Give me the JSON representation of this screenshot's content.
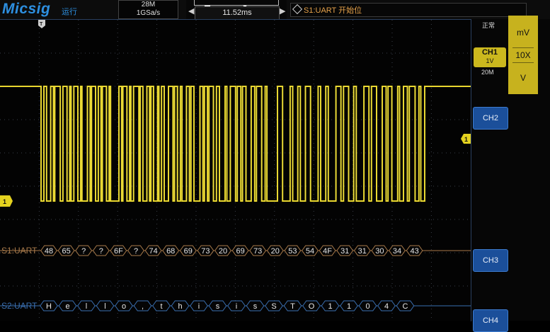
{
  "brand": {
    "logo": "Micsig",
    "subtitle": "运行"
  },
  "acquisition": {
    "memory_depth": "28M",
    "sample_rate": "1GSa/s"
  },
  "timebase": {
    "value": "11.52ms"
  },
  "trigger": {
    "info": "S1:UART 开始位"
  },
  "trigger_mode": "正常",
  "channel1": {
    "label": "CH1",
    "scale": "1V",
    "bandwidth": "20M",
    "color": "#e4d21f"
  },
  "probe_menu": {
    "items": [
      "mV",
      "10X",
      "V"
    ],
    "selected": "10X"
  },
  "channel_buttons": [
    "CH2",
    "CH3",
    "CH4"
  ],
  "markers": {
    "ch1": "1",
    "trigger_level": "1",
    "trigger_pos": "T"
  },
  "colors": {
    "uart1": "#a87a4a",
    "uart2": "#3a6fb0",
    "ch_button": "#1b4f9a",
    "grid": "#3a3f48"
  },
  "serial_decode": [
    {
      "label": "S1:UART",
      "bytes": [
        "48",
        "65",
        "?",
        "?",
        "6F",
        "?",
        "74",
        "68",
        "69",
        "73",
        "20",
        "69",
        "73",
        "20",
        "53",
        "54",
        "4F",
        "31",
        "31",
        "30",
        "34",
        "43"
      ]
    },
    {
      "label": "S2:UART",
      "chars": [
        "H",
        "e",
        "l",
        "l",
        "o",
        ",",
        "t",
        "h",
        "i",
        "s",
        "i",
        "s",
        "S",
        "T",
        "O",
        "1",
        "1",
        "0",
        "4",
        "C"
      ]
    }
  ],
  "waveform_bursts": [
    {
      "widths": [
        2,
        3,
        2,
        1,
        4,
        2,
        3,
        2,
        1,
        2,
        3,
        2,
        1,
        4,
        2,
        1,
        3,
        2,
        2,
        1,
        3,
        2,
        1,
        2
      ]
    },
    {
      "widths": [
        2,
        1,
        3,
        2,
        1,
        2,
        4,
        1,
        2,
        3,
        2,
        1,
        2,
        3,
        1,
        2,
        2
      ]
    },
    {
      "widths": [
        3,
        1,
        2,
        2,
        1,
        3,
        2,
        1,
        2,
        4,
        2,
        1,
        2,
        1,
        3,
        2,
        2
      ]
    },
    {
      "widths": [
        1,
        2,
        3,
        1,
        2,
        1,
        2,
        3,
        2,
        1,
        3,
        2,
        1,
        2
      ]
    },
    {
      "widths": [
        2,
        3,
        1,
        2,
        1,
        2,
        2,
        3,
        1,
        2,
        1,
        3,
        2,
        1,
        2,
        2,
        1,
        3,
        2,
        1,
        2
      ]
    },
    {
      "widths": [
        2,
        1,
        2,
        3,
        1,
        2,
        2,
        1,
        3,
        2,
        1,
        2
      ]
    }
  ]
}
